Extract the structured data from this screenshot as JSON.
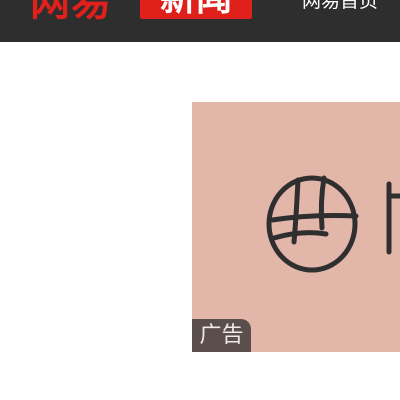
{
  "header": {
    "logo_brand": "网易",
    "logo_section": "新闻",
    "nav_home_label": "网易首页",
    "background_color": "#2e2e2e",
    "brand_color": "#e0201a"
  },
  "ad": {
    "badge_label": "广告",
    "background_color": "#e3b6aa",
    "badge_color": "#5b4f4d"
  }
}
